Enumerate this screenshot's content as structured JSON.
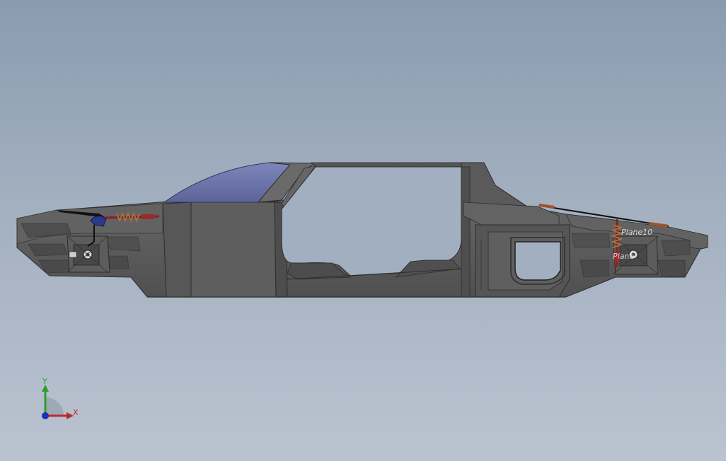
{
  "viewport": {
    "background_top": "#8a9bb0",
    "background_bottom": "#bac3d0"
  },
  "model": {
    "body_color": "#5a5a5a",
    "body_dark": "#444444",
    "body_light": "#6e6e6e",
    "canopy_color": "#6a74a8",
    "spring_color": "#a0522d",
    "annotations": {
      "plane_upper": "Plane10",
      "plane_lower": "Plane"
    }
  },
  "triad": {
    "x_label": "X",
    "y_label": "Y",
    "x_color": "#c0282a",
    "y_color": "#2aa02a",
    "z_color": "#2030b0"
  }
}
